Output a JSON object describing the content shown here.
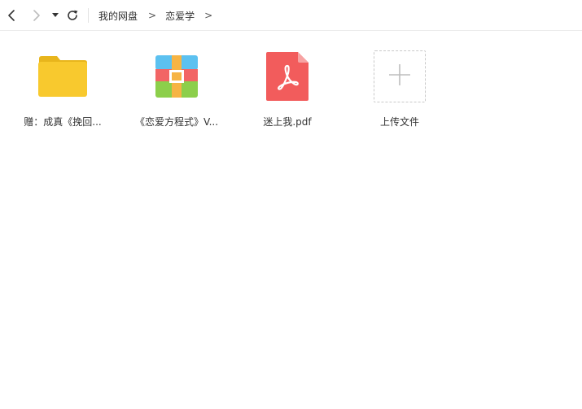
{
  "window": {
    "title": "恋爱学"
  },
  "toolbar": {
    "back_icon": "chevron-left-icon",
    "forward_icon": "chevron-right-icon",
    "history_icon": "caret-down-icon",
    "refresh_icon": "refresh-icon"
  },
  "breadcrumb": {
    "items": [
      "我的网盘",
      "恋爱学"
    ],
    "separator": ">"
  },
  "files": [
    {
      "name": "赠：成真《挽回...",
      "type": "folder",
      "icon": "folder-icon"
    },
    {
      "name": "《恋爱方程式》V...",
      "type": "archive",
      "icon": "archive-icon"
    },
    {
      "name": "迷上我.pdf",
      "type": "pdf",
      "icon": "pdf-icon"
    }
  ],
  "upload": {
    "label": "上传文件",
    "icon": "plus-icon"
  },
  "colors": {
    "folder": "#F8C92E",
    "folder_tab": "#E8B51C",
    "archive_top": "#5CC1F0",
    "archive_mid": "#F26565",
    "archive_bottom": "#8CCF4B",
    "archive_strap": "#F6B444",
    "pdf": "#F25C5C",
    "pdf_fold": "#F7A3A3"
  }
}
